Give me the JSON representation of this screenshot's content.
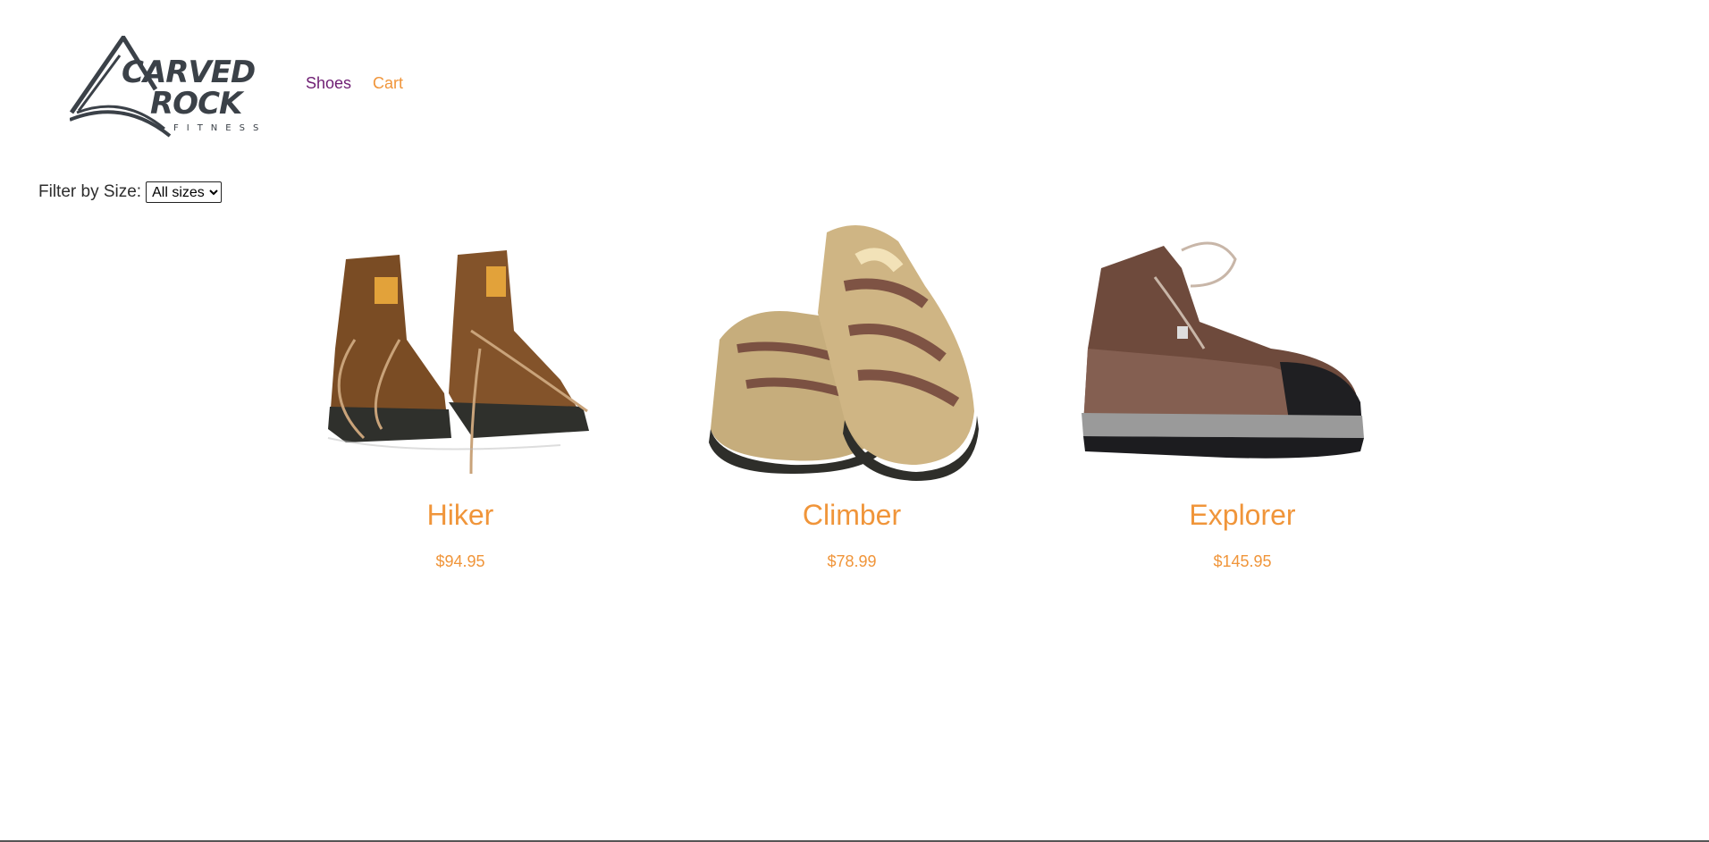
{
  "brand": {
    "logo_line1": "CARVED",
    "logo_line2": "ROCK",
    "logo_line3": "FITNESS"
  },
  "nav": {
    "items": [
      {
        "label": "Shoes"
      },
      {
        "label": "Cart"
      }
    ]
  },
  "filter": {
    "label": "Filter by Size:",
    "selected": "All sizes"
  },
  "products": [
    {
      "name": "Hiker",
      "price": "$94.95",
      "image": "hiking-boots-pair"
    },
    {
      "name": "Climber",
      "price": "$78.99",
      "image": "sport-sandals-pair"
    },
    {
      "name": "Explorer",
      "price": "$145.95",
      "image": "hiking-boot-single"
    }
  ],
  "colors": {
    "accent": "#f0953a",
    "nav_visited": "#6e1e73",
    "text": "#2d2d2d"
  }
}
